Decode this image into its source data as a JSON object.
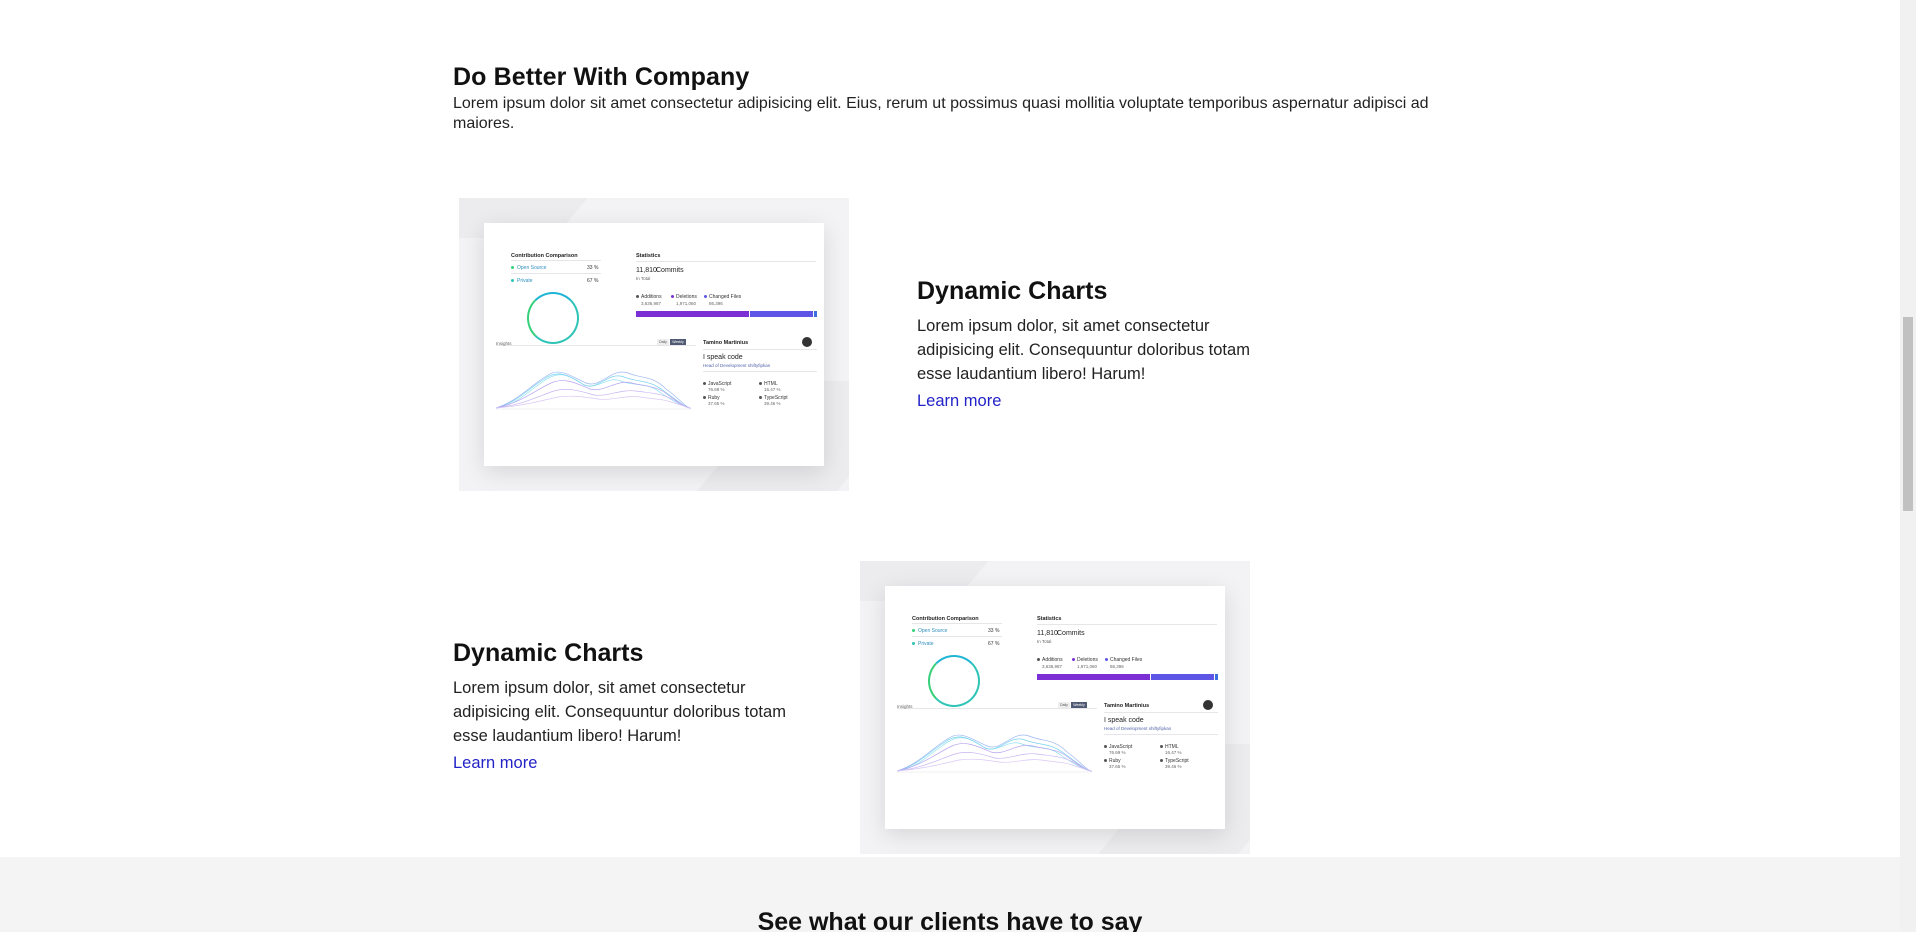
{
  "intro": {
    "title": "Do Better With Company",
    "body": "Lorem ipsum dolor sit amet consectetur adipisicing elit. Eius, rerum ut possimus quasi mollitia voluptate temporibus aspernatur adipisci ad maiores."
  },
  "features": [
    {
      "title": "Dynamic Charts",
      "body": "Lorem ipsum dolor, sit amet consectetur adipisicing elit. Consequuntur doloribus totam esse laudantium libero! Harum!",
      "link": "Learn more"
    },
    {
      "title": "Dynamic Charts",
      "body": "Lorem ipsum dolor, sit amet consectetur adipisicing elit. Consequuntur doloribus totam esse laudantium libero! Harum!",
      "link": "Learn more"
    }
  ],
  "mockup": {
    "contribution_title": "Contribution Comparison",
    "open_source": "Open Source",
    "open_source_pct": "33 %",
    "private": "Private",
    "private_pct": "67 %",
    "statistics_title": "Statistics",
    "commits_count": "11,810",
    "commits_label": "Commits",
    "in_total": "In Total",
    "additions_label": "Additions",
    "additions_value": "3,636,987",
    "deletions_label": "Deletions",
    "deletions_value": "1,971,060",
    "changed_label": "Changed Files",
    "changed_value": "86,396",
    "chart_title": "Insights",
    "btn_daily": "Daily",
    "btn_weekly": "Weekly",
    "profile_name": "Tamino Martinius",
    "profile_tagline": "I speak code",
    "profile_role": "Head of Development shiftyfipkan",
    "lang_js": "JavaScript",
    "lang_js_pct": "76.69 %",
    "lang_html": "HTML",
    "lang_html_pct": "16.47 %",
    "lang_ruby": "Ruby",
    "lang_ruby_pct": "37.65 %",
    "lang_ts": "TypeScript",
    "lang_ts_pct": "39.46 %"
  },
  "clients": {
    "title": "See what our clients have to say"
  },
  "colors": {
    "link": "#2323c8",
    "bar_purple": "#7b2fd4",
    "bar_indigo": "#5c55e6",
    "ring": "#2ec4b6"
  }
}
